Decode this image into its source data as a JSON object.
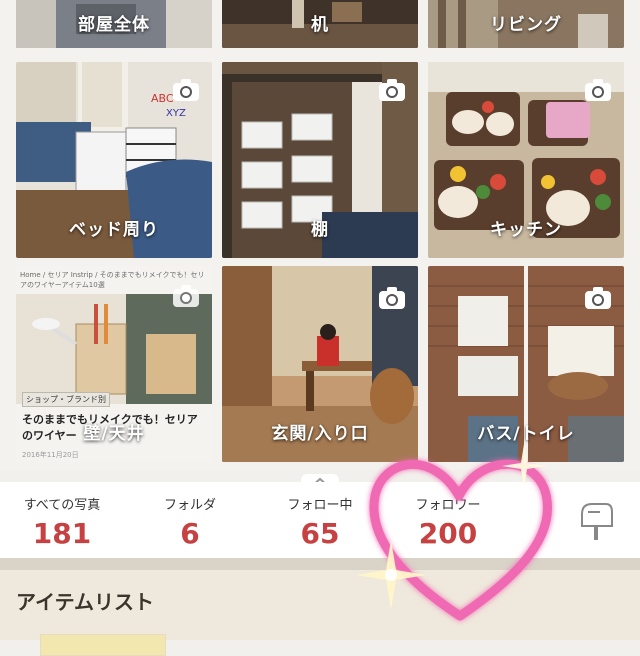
{
  "folders": [
    {
      "label": "部屋全体"
    },
    {
      "label": "机"
    },
    {
      "label": "リビング"
    },
    {
      "label": "ベッド周り"
    },
    {
      "label": "棚"
    },
    {
      "label": "キッチン"
    },
    {
      "label": "壁/天井",
      "breadcrumb": "Home / セリア Instrip / そのままでもリメイクでも！セリアのワイヤーアイテム10選",
      "tag": "ショップ・ブランド別",
      "headline": "そのままでもリメイクでも！セリアのワイヤー",
      "date": "2016年11月20日"
    },
    {
      "label": "玄関/入り口"
    },
    {
      "label": "バス/トイレ"
    }
  ],
  "stats": [
    {
      "label": "すべての写真",
      "value": "181"
    },
    {
      "label": "フォルダ",
      "value": "6"
    },
    {
      "label": "フォロー中",
      "value": "65"
    },
    {
      "label": "フォロワー",
      "value": "200"
    }
  ],
  "item_list": {
    "title": "アイテムリスト"
  },
  "icons": {
    "camera": "camera-icon",
    "mailbox": "mailbox-icon",
    "collapse": "chevron-up-icon",
    "heart": "heart-icon"
  },
  "colors": {
    "accent": "#c64142",
    "heart": "#f06bb3"
  }
}
